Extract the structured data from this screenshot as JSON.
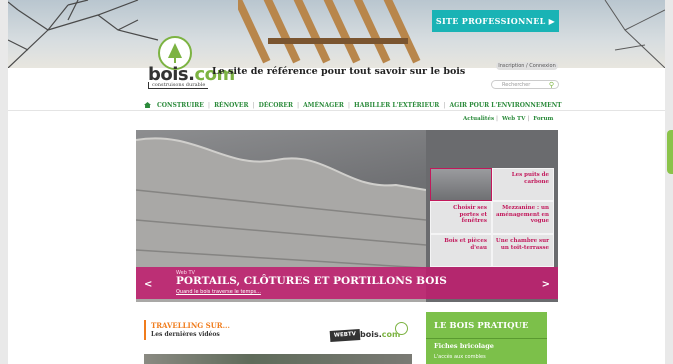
{
  "header": {
    "pro_button": "SITE PROFESSIONNEL ▶",
    "logo_main": "bois.",
    "logo_accent": "com",
    "logo_sub": "construisons durable",
    "tagline": "Le site de référence pour tout savoir sur le bois",
    "login": "Inscription / Connexion",
    "search_placeholder": "Rechercher"
  },
  "nav": {
    "items": [
      "CONSTRUIRE",
      "RÉNOVER",
      "DÉCORER",
      "AMÉNAGER",
      "HABILLER L'EXTÉRIEUR",
      "AGIR POUR L'ENVIRONNEMENT"
    ]
  },
  "sublinks": [
    "Actualités",
    "Web TV",
    "Forum"
  ],
  "banner": {
    "label": "Web TV",
    "title": "PORTAILS, CLÔTURES ET PORTILLONS BOIS",
    "link": "Quand le bois traverse le temps...",
    "prev": "<",
    "next": ">",
    "tiles": [
      "",
      "Les puits de carbone",
      "Choisir ses portes et fenêtres",
      "Mezzanine : un aménagement en vogue",
      "Bois et pièces d'eau",
      "Une chambre sur un toit-terrasse"
    ]
  },
  "travelling": {
    "title": "TRAVELLING SUR...",
    "subtitle": "Les dernières vidéos",
    "webtv_badge": "WEBTV",
    "webtv_logo": "bois.",
    "webtv_logo_accent": "com"
  },
  "pratique": {
    "title": "LE BOIS PRATIQUE",
    "section": "Fiches bricolage",
    "link": "L'accès aux combles"
  },
  "colors": {
    "green": "#7cb342",
    "magenta": "#c2185b",
    "teal": "#19b3b5",
    "orange": "#f07c1c"
  }
}
